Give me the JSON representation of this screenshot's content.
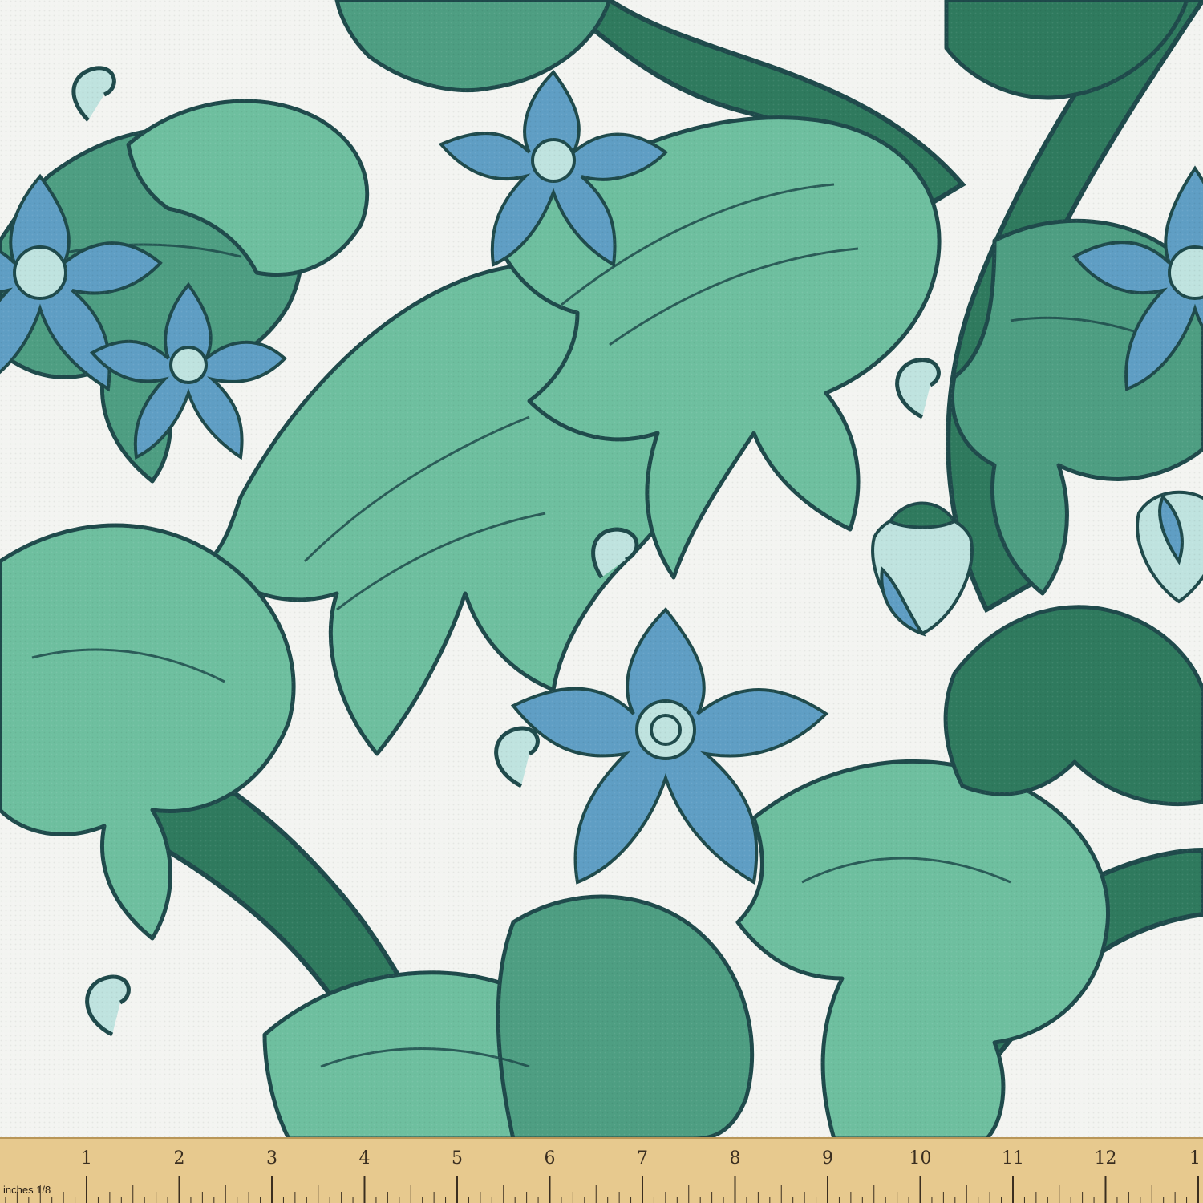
{
  "fabric": {
    "colors": {
      "background": "#f3f4f1",
      "outline": "#1f4a4b",
      "leaf_light": "#6ebf9f",
      "leaf_mid": "#4e9e82",
      "leaf_dark": "#2f7a5e",
      "flower_blue": "#5f9ec4",
      "flower_center": "#bfe3df"
    }
  },
  "ruler": {
    "unit_label": "inches 1/8",
    "numbers": [
      "1",
      "2",
      "3",
      "4",
      "5",
      "6",
      "7",
      "8",
      "9",
      "10",
      "11",
      "12",
      "1"
    ]
  }
}
